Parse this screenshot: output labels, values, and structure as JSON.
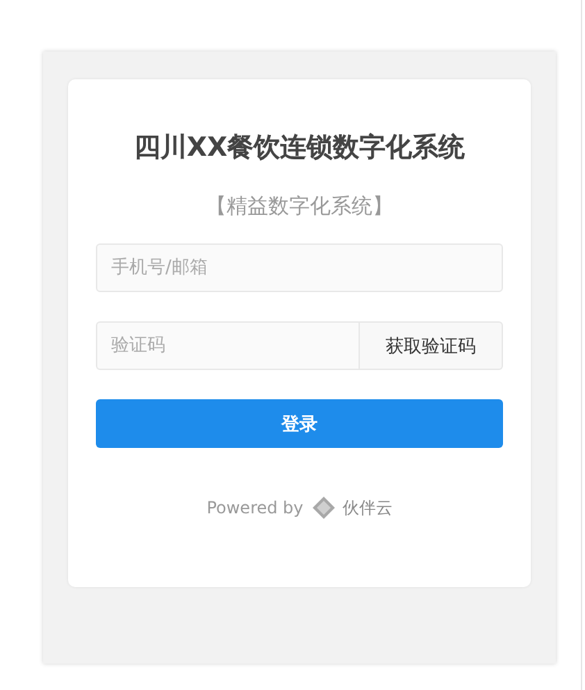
{
  "title": "四川XX餐饮连锁数字化系统",
  "subtitle": "【精益数字化系统】",
  "phone_field": {
    "placeholder": "手机号/邮箱"
  },
  "code_field": {
    "placeholder": "验证码"
  },
  "get_code_button": "获取验证码",
  "login_button": "登录",
  "footer": {
    "powered_by": "Powered by",
    "brand": "伙伴云"
  }
}
